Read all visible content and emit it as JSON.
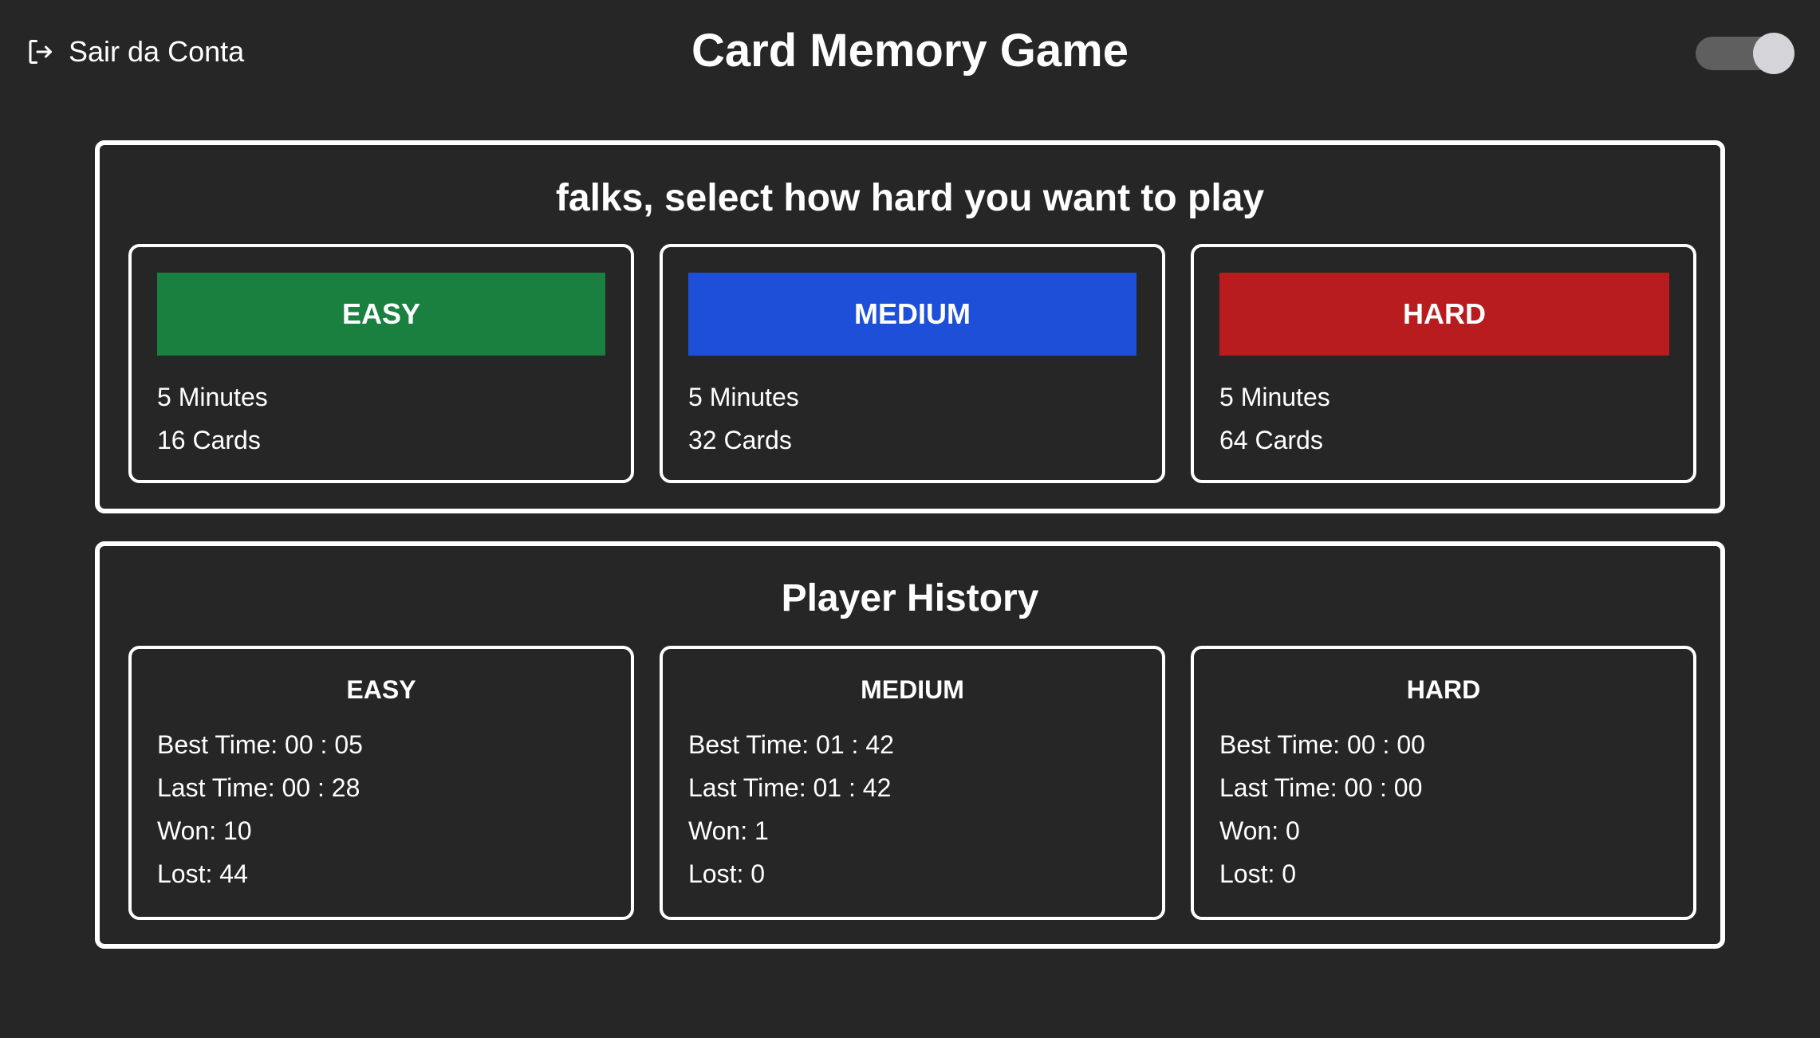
{
  "header": {
    "logout_label": "Sair da Conta",
    "title": "Card Memory Game",
    "theme_toggle_on": true
  },
  "difficulty": {
    "title": "falks, select how hard you want to play",
    "levels": [
      {
        "label": "EASY",
        "time": "5 Minutes",
        "cards": "16 Cards",
        "color": "#19803f"
      },
      {
        "label": "MEDIUM",
        "time": "5 Minutes",
        "cards": "32 Cards",
        "color": "#1e4fd9"
      },
      {
        "label": "HARD",
        "time": "5 Minutes",
        "cards": "64 Cards",
        "color": "#b91c1e"
      }
    ]
  },
  "history": {
    "title": "Player History",
    "levels": [
      {
        "label": "EASY",
        "best": "Best Time: 00 : 05",
        "last": "Last Time: 00 : 28",
        "won": "Won: 10",
        "lost": "Lost: 44"
      },
      {
        "label": "MEDIUM",
        "best": "Best Time: 01 : 42",
        "last": "Last Time: 01 : 42",
        "won": "Won: 1",
        "lost": "Lost: 0"
      },
      {
        "label": "HARD",
        "best": "Best Time: 00 : 00",
        "last": "Last Time: 00 : 00",
        "won": "Won: 0",
        "lost": "Lost: 0"
      }
    ]
  }
}
